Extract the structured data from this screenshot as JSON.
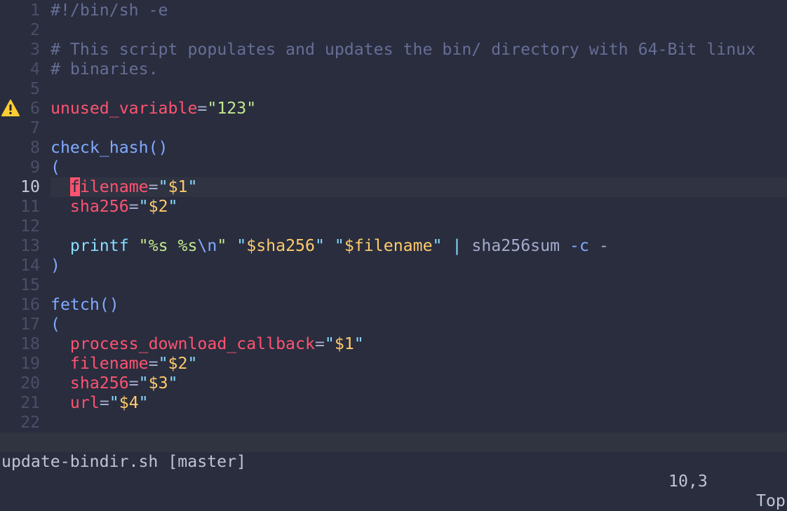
{
  "colors": {
    "background": "#292d3e",
    "variable": "#ff5370",
    "string": "#c3e88d",
    "function": "#82aaff",
    "operator": "#89ddff",
    "expansion": "#ffcb6b",
    "comment": "#676e95",
    "warning": "#ffcc33"
  },
  "editor": {
    "current_line": 10,
    "lines": [
      {
        "n": "1",
        "segs": [
          [
            "#!/bin/sh -e",
            "comment"
          ]
        ]
      },
      {
        "n": "2",
        "segs": []
      },
      {
        "n": "3",
        "segs": [
          [
            "# This script populates and updates the bin/ directory with 64-Bit linux",
            "comment"
          ]
        ]
      },
      {
        "n": "4",
        "segs": [
          [
            "# binaries.",
            "comment"
          ]
        ]
      },
      {
        "n": "5",
        "segs": []
      },
      {
        "n": "6",
        "sign": "warning-icon",
        "segs": [
          [
            "unused_variable",
            "var"
          ],
          [
            "=",
            "plain"
          ],
          [
            "\"123\"",
            "str"
          ]
        ]
      },
      {
        "n": "7",
        "segs": []
      },
      {
        "n": "8",
        "segs": [
          [
            "check_hash()",
            "fn"
          ]
        ]
      },
      {
        "n": "9",
        "segs": [
          [
            "(",
            "fn"
          ]
        ]
      },
      {
        "n": "10",
        "segs": [
          [
            "  ",
            "plain"
          ],
          [
            "f",
            "cursor"
          ],
          [
            "ilename",
            "var"
          ],
          [
            "=",
            "plain"
          ],
          [
            "\"",
            "cyan"
          ],
          [
            "$1",
            "yel"
          ],
          [
            "\"",
            "cyan"
          ]
        ]
      },
      {
        "n": "11",
        "segs": [
          [
            "  ",
            "plain"
          ],
          [
            "sha256",
            "var"
          ],
          [
            "=",
            "plain"
          ],
          [
            "\"",
            "cyan"
          ],
          [
            "$2",
            "yel"
          ],
          [
            "\"",
            "cyan"
          ]
        ]
      },
      {
        "n": "12",
        "segs": []
      },
      {
        "n": "13",
        "segs": [
          [
            "  ",
            "plain"
          ],
          [
            "printf",
            "cyan"
          ],
          [
            " ",
            "plain"
          ],
          [
            "\"%s %s",
            "str"
          ],
          [
            "\\n",
            "fn"
          ],
          [
            "\"",
            "str"
          ],
          [
            " ",
            "plain"
          ],
          [
            "\"",
            "cyan"
          ],
          [
            "$sha256",
            "yel"
          ],
          [
            "\"",
            "cyan"
          ],
          [
            " ",
            "plain"
          ],
          [
            "\"",
            "cyan"
          ],
          [
            "$filename",
            "yel"
          ],
          [
            "\"",
            "cyan"
          ],
          [
            " ",
            "plain"
          ],
          [
            "|",
            "cyan"
          ],
          [
            " sha256sum ",
            "plain"
          ],
          [
            "-c",
            "fn"
          ],
          [
            " -",
            "plain"
          ]
        ]
      },
      {
        "n": "14",
        "segs": [
          [
            ")",
            "fn"
          ]
        ]
      },
      {
        "n": "15",
        "segs": []
      },
      {
        "n": "16",
        "segs": [
          [
            "fetch()",
            "fn"
          ]
        ]
      },
      {
        "n": "17",
        "segs": [
          [
            "(",
            "fn"
          ]
        ]
      },
      {
        "n": "18",
        "segs": [
          [
            "  ",
            "plain"
          ],
          [
            "process_download_callback",
            "var"
          ],
          [
            "=",
            "plain"
          ],
          [
            "\"",
            "cyan"
          ],
          [
            "$1",
            "yel"
          ],
          [
            "\"",
            "cyan"
          ]
        ]
      },
      {
        "n": "19",
        "segs": [
          [
            "  ",
            "plain"
          ],
          [
            "filename",
            "var"
          ],
          [
            "=",
            "plain"
          ],
          [
            "\"",
            "cyan"
          ],
          [
            "$2",
            "yel"
          ],
          [
            "\"",
            "cyan"
          ]
        ]
      },
      {
        "n": "20",
        "segs": [
          [
            "  ",
            "plain"
          ],
          [
            "sha256",
            "var"
          ],
          [
            "=",
            "plain"
          ],
          [
            "\"",
            "cyan"
          ],
          [
            "$3",
            "yel"
          ],
          [
            "\"",
            "cyan"
          ]
        ]
      },
      {
        "n": "21",
        "segs": [
          [
            "  ",
            "plain"
          ],
          [
            "url",
            "var"
          ],
          [
            "=",
            "plain"
          ],
          [
            "\"",
            "cyan"
          ],
          [
            "$4",
            "yel"
          ],
          [
            "\"",
            "cyan"
          ]
        ]
      },
      {
        "n": "22",
        "segs": []
      }
    ]
  },
  "status": {
    "file": "update-bindir.sh [master]",
    "position": "10,3",
    "scroll": "Top"
  }
}
